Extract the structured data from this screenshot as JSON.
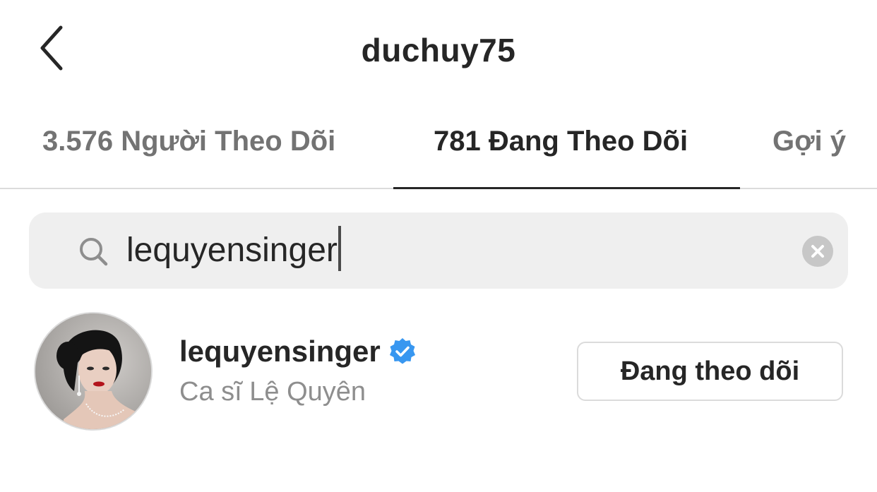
{
  "header": {
    "title": "duchuy75",
    "back_icon": "chevron-left-icon"
  },
  "tabs": [
    {
      "label": "3.576 Người Theo Dõi",
      "active": false
    },
    {
      "label": "781 Đang Theo Dõi",
      "active": true
    },
    {
      "label": "Gợi ý",
      "active": false
    }
  ],
  "search": {
    "value": "lequyensinger",
    "icon": "search-icon",
    "clear_icon": "clear-icon"
  },
  "results": [
    {
      "username": "lequyensinger",
      "verified": true,
      "full_name": "Ca sĩ Lệ Quyên",
      "button_label": "Đang theo dõi"
    }
  ],
  "colors": {
    "text_primary": "#262626",
    "text_secondary": "#8e8e8e",
    "verified_blue": "#3897f0",
    "search_bg": "#efefef",
    "border": "#dbdbdb"
  }
}
